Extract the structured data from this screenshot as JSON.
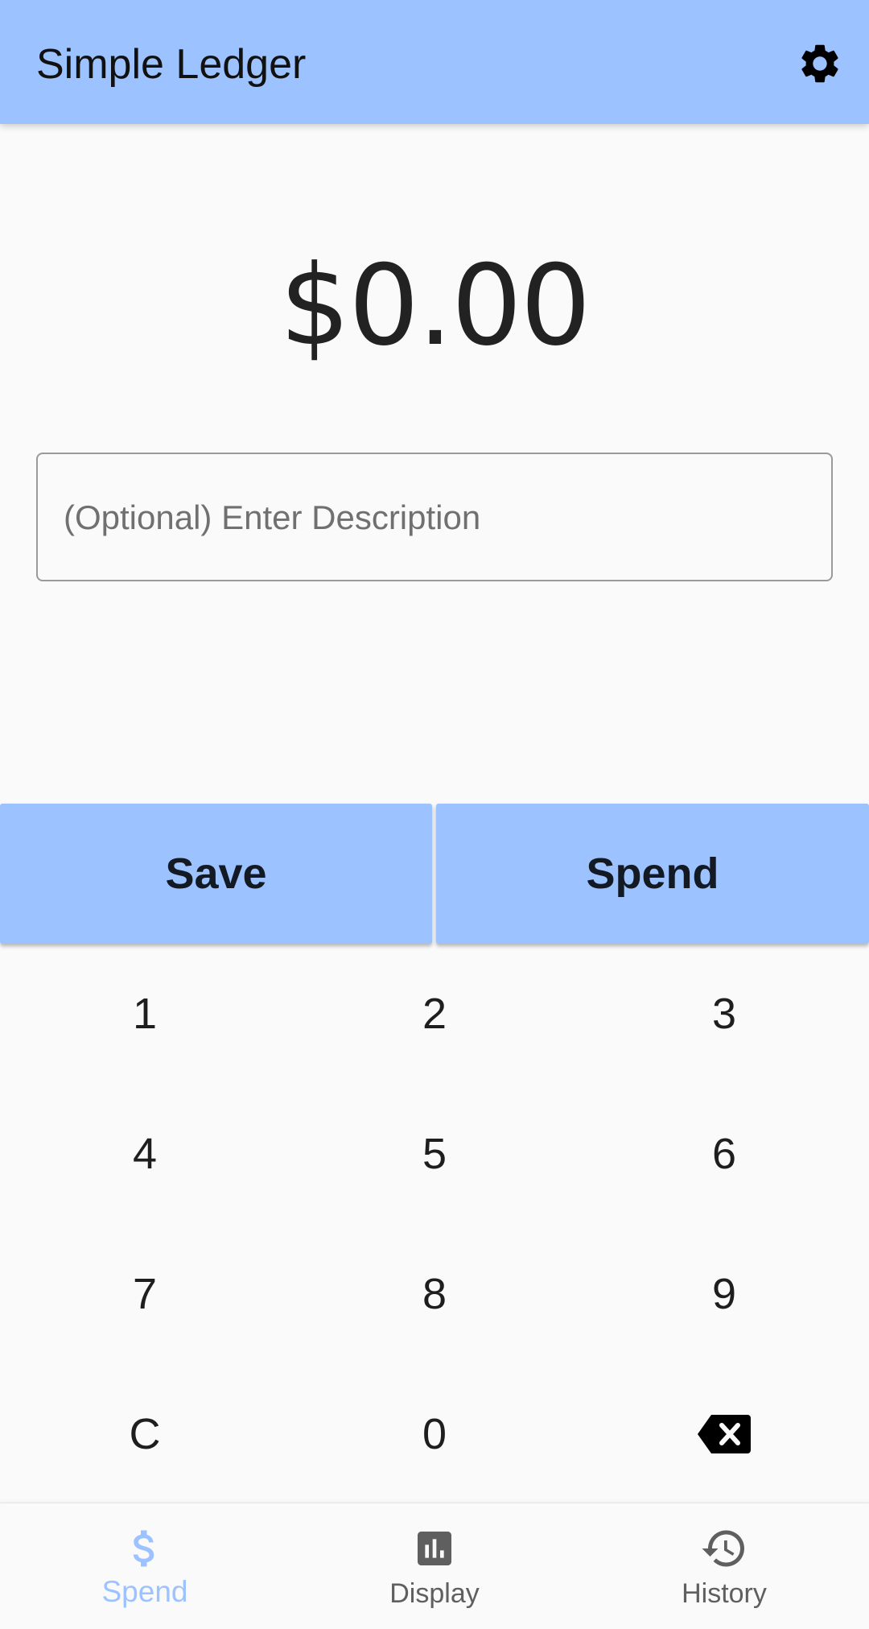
{
  "app_bar": {
    "title": "Simple Ledger",
    "settings_icon": "gear-icon"
  },
  "amount": {
    "display": "$0.00"
  },
  "description": {
    "placeholder": "(Optional) Enter Description",
    "value": ""
  },
  "actions": {
    "save_label": "Save",
    "spend_label": "Spend"
  },
  "keypad": {
    "keys": [
      "1",
      "2",
      "3",
      "4",
      "5",
      "6",
      "7",
      "8",
      "9",
      "C",
      "0"
    ],
    "backspace_icon": "backspace-icon"
  },
  "bottom_nav": {
    "items": [
      {
        "label": "Spend",
        "icon": "dollar-icon",
        "active": true
      },
      {
        "label": "Display",
        "icon": "bar-chart-icon",
        "active": false
      },
      {
        "label": "History",
        "icon": "history-icon",
        "active": false
      }
    ]
  },
  "colors": {
    "primary": "#9cc2ff",
    "background": "#fafafa",
    "text": "#1f1f1f",
    "nav_inactive": "#5f5f5f"
  }
}
